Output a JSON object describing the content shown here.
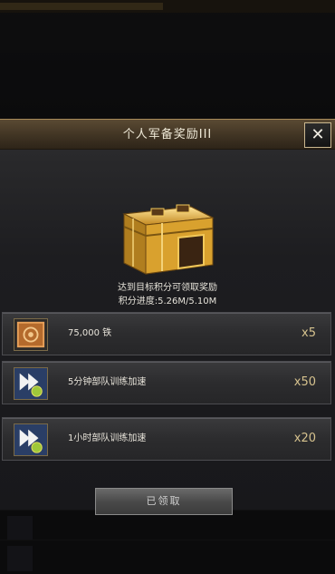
{
  "modal": {
    "title": "个人军备奖励III",
    "close_symbol": "✕",
    "goal_text": "达到目标积分可领取奖励",
    "progress_label": "积分进度:",
    "progress_current": "5.26M",
    "progress_separator": "/",
    "progress_target": "5.10M",
    "rewards": [
      {
        "name": "75,000 铁",
        "count": "x5",
        "icon": "iron-icon"
      },
      {
        "name": "5分钟部队训练加速",
        "count": "x50",
        "icon": "speedup-icon"
      },
      {
        "name": "1小时部队训练加速",
        "count": "x20",
        "icon": "speedup-icon"
      }
    ],
    "claim_label": "已领取"
  },
  "colors": {
    "header": "#3e3222",
    "header_border": "#a88b5a",
    "count_text": "#d6c28e",
    "chest_gold": "#d9a733"
  }
}
